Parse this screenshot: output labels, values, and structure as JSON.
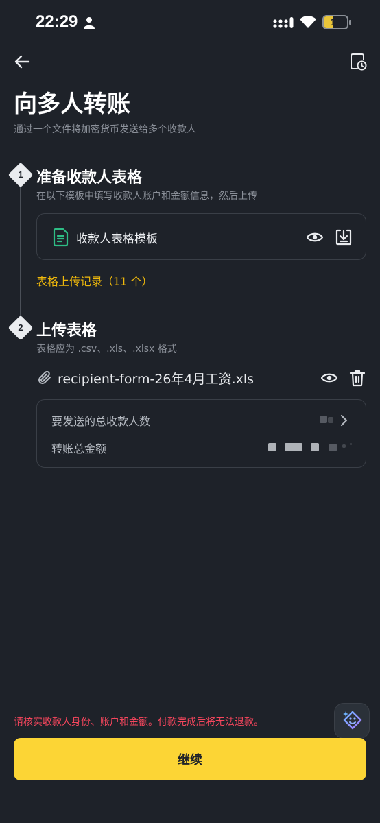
{
  "status_bar": {
    "time": "22:29",
    "battery_level": "17",
    "colors": {
      "battery_fill": "#e9c53a"
    }
  },
  "header": {
    "back_icon": "arrow-left-icon",
    "history_icon": "history-icon",
    "title": "向多人转账",
    "subtitle": "通过一个文件将加密货币发送给多个收款人"
  },
  "steps": [
    {
      "number": "1",
      "title": "准备收款人表格",
      "description": "在以下模板中填写收款人账户和金额信息，然后上传",
      "template": {
        "icon": "document-icon",
        "label": "收款人表格模板",
        "preview_icon": "eye-icon",
        "download_icon": "download-icon"
      },
      "history_link": "表格上传记录（11 个）"
    },
    {
      "number": "2",
      "title": "上传表格",
      "description": "表格应为 .csv、.xls、.xlsx 格式",
      "file": {
        "icon": "paperclip-icon",
        "name": "recipient-form-26年4月工资.xls",
        "preview_icon": "eye-icon",
        "delete_icon": "trash-icon"
      },
      "summary": {
        "recipients_label": "要发送的总收款人数",
        "amount_label": "转账总金额"
      }
    }
  ],
  "footer": {
    "warning": "请核实收款人身份、账户和金额。付款完成后将无法退款。",
    "continue_label": "继续",
    "assistant_icon": "ai-assistant-icon"
  },
  "colors": {
    "background": "#1e2229",
    "accent": "#fcd535",
    "link": "#f0b90b",
    "warning": "#f6465d",
    "template_icon": "#2ebd85"
  }
}
